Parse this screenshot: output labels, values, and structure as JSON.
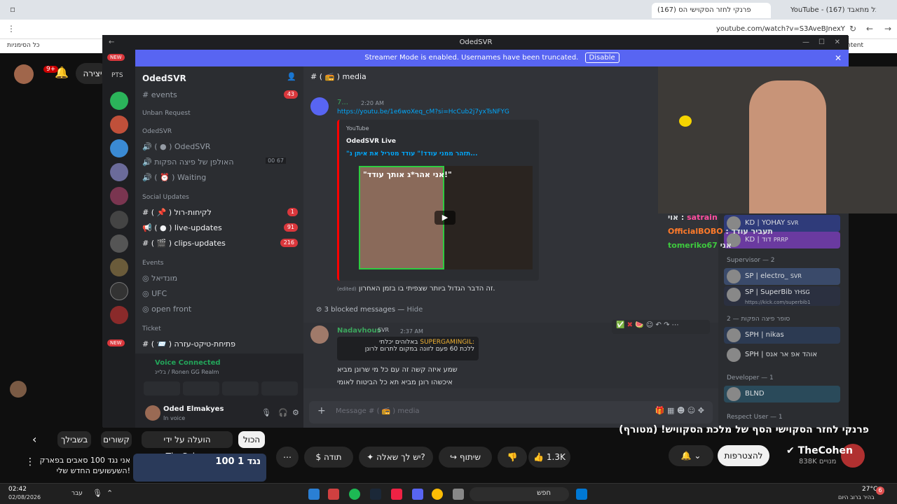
{
  "chrome": {
    "tab1": "YouTube - חתכל מתאבד (167)",
    "tab2": "(167) פרנקי לחזר הסקוישי הס",
    "url": "youtube.com/watch?v=S3AveBJnexY",
    "bookmarks": "כל הסימניות",
    "bm_right": "ntent"
  },
  "discord": {
    "window_title": "OdedSVR",
    "banner": "Streamer Mode is enabled. Usernames have been truncated.",
    "disable_button": "Disable",
    "server_name": "OdedSVR",
    "channel_header": "( 📻 ) media",
    "channels": [
      {
        "label": "events",
        "prefix": "#",
        "badge": "43"
      },
      {
        "label": "Unban Request",
        "type": "category"
      },
      {
        "label": "OdedSVR",
        "type": "category"
      },
      {
        "label": "OdedSVR",
        "prefix": "🔊"
      },
      {
        "label": "האולפן של פיצה הפקות",
        "prefix": "🔊",
        "extra": "00  67"
      },
      {
        "label": "Waiting",
        "prefix": "🔊"
      },
      {
        "label": "Social Updates",
        "type": "category"
      },
      {
        "label": "לקיחות-רול",
        "prefix": "#",
        "badge": "1"
      },
      {
        "label": "live-updates",
        "prefix": "📢",
        "badge": "91"
      },
      {
        "label": "clips-updates",
        "prefix": "#",
        "badge": "216"
      },
      {
        "label": "Events",
        "type": "category"
      },
      {
        "label": "מונדיאל",
        "prefix": "◎"
      },
      {
        "label": "UFC",
        "prefix": "◎"
      },
      {
        "label": "open front",
        "prefix": "◎"
      },
      {
        "label": "Ticket",
        "type": "category"
      },
      {
        "label": "פתיחת-טיקט-עזרה",
        "prefix": "#"
      }
    ],
    "voice": {
      "status": "Voice Connected",
      "channel": "בליינ / Ronen GG Realm"
    },
    "user": {
      "name": "Oded Elmakyes",
      "status": "In voice"
    },
    "messages": {
      "m1_author": "7...",
      "m1_time": "2:20 AM",
      "m1_link": "https://youtu.be/1e6woXeq_cM?si=HcCub2j7yxTsNFYG",
      "edited": "(edited)",
      "embed_provider": "YouTube",
      "embed_author": "OdedSVR Live",
      "embed_title": "\"תזהר ממני עודד!\" עודד מטריל את איתן נ...",
      "thumb_text": "\"אני אהר*ג אותך עודד!\"",
      "m1_text": "זה הדבר הגדול ביותר שצפיתי בו בזמן האחרון.",
      "blocked": "3 blocked messages — ",
      "hide": "Hide",
      "m2_author": "Nadavhous",
      "m2_tag": "SVR",
      "m2_time": "2:37 AM",
      "m2_reply_name": "SUPERGAMINGIL:",
      "m2_reply": "באלוהים יכלתי",
      "m2_reply2": "ללכת 60 פעם לזונה במקום לתרום לרונן",
      "m2_line1": "שמע איזה קשה זה עם כל מי שרונן מביא",
      "m2_line2": "איכשהו רונן מביא תא כל  הביטוח לאומי"
    },
    "input_placeholder": "Message # ( 📻 ) media",
    "members": [
      {
        "name": "KD | YOHAY",
        "tag": "SVR"
      },
      {
        "name": "KD | דוד",
        "tag": "PRRP"
      },
      {
        "section": "Supervisor — 2"
      },
      {
        "name": "SP | electro_",
        "tag": "SVR"
      },
      {
        "name": "SP | SuperBib",
        "tag": "YHSG",
        "sub": "https://kick.com/superbib1"
      },
      {
        "section": "סופר פיצה הפקות — 2"
      },
      {
        "name": "SPH | nikas"
      },
      {
        "name": "SPH | אוהד אפ אר אנס"
      },
      {
        "section": "Developer — 1"
      },
      {
        "name": "BLND"
      },
      {
        "section": "Respect User — 1"
      }
    ],
    "chat_overlay": [
      {
        "name": "satrain",
        "text": "אוי"
      },
      {
        "name": "OfficialBOBO",
        "text": "תעביר עודד"
      },
      {
        "name": "tomeriko67",
        "text": "אני"
      }
    ]
  },
  "youtube": {
    "create": "יצירה",
    "notif": "9+",
    "title": "פרנקי לחזר הסקוישי הסף של מלכת הסקוויש! (מטורף)",
    "channel": "TheCohen",
    "subs": "838K מנויים",
    "subscribe": "להצטרפות",
    "likes": "1.3K",
    "share": "שיתוף",
    "ask": "יש לך שאלה?",
    "thanks": "תודה",
    "chips": [
      "הכול",
      "הועלה על ידי TheCohen",
      "קשורים",
      "בשבילך"
    ],
    "rec_title": "אני נגד 100 סאבים בפארק השעשועים החדש שלי!",
    "rec_thumb": "100 נגד 1"
  },
  "taskbar": {
    "time": "02:42",
    "date": "02/08/2026",
    "lang": "עבר",
    "search": "חפש",
    "weather": "27°C",
    "weather_sub": "בהיר ברוב היום",
    "notif": "6"
  }
}
